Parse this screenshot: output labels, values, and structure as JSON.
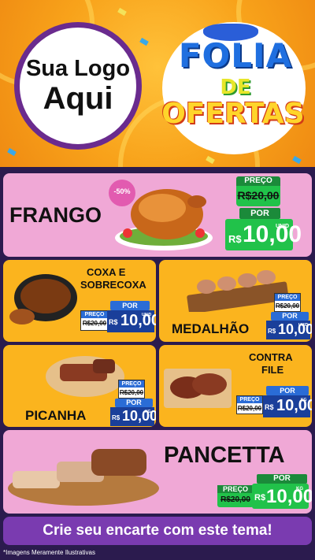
{
  "logo": {
    "line1": "Sua Logo",
    "line2": "Aqui"
  },
  "title": {
    "word1": "FOLIA",
    "word2": "DE",
    "word3": "OFERTAS"
  },
  "products": {
    "frango": {
      "name": "FRANGO",
      "discount": "-50%",
      "price_label": "PREÇO",
      "old_price": "R$20,00",
      "por_label": "POR",
      "currency": "R$",
      "price": "10,00",
      "unit": "UNID"
    },
    "coxa": {
      "name_line1": "COXA E",
      "name_line2": "SOBRECOXA",
      "price_label": "PREÇO",
      "old_price": "R$20,00",
      "por_label": "POR",
      "currency": "R$",
      "price": "10,00",
      "unit": "UNID"
    },
    "medalhao": {
      "name": "MEDALHÃO",
      "price_label": "PREÇO",
      "old_price": "R$20,00",
      "por_label": "POR",
      "currency": "R$",
      "price": "10,00",
      "unit": "UNID"
    },
    "picanha": {
      "name": "PICANHA",
      "price_label": "PREÇO",
      "old_price": "R$20,00",
      "por_label": "POR",
      "currency": "R$",
      "price": "10,00",
      "unit": "KG"
    },
    "contrafile": {
      "name_line1": "CONTRA",
      "name_line2": "FILE",
      "price_label": "PREÇO",
      "old_price": "R$20,00",
      "por_label": "POR",
      "currency": "R$",
      "price": "10,00",
      "unit": "KG"
    },
    "pancetta": {
      "name": "PANCETTA",
      "price_label": "PREÇO",
      "old_price": "R$20,00",
      "por_label": "POR",
      "currency": "R$",
      "price": "10,00",
      "unit": "KG"
    }
  },
  "banner": {
    "text": "Crie seu encarte com este tema!"
  },
  "footnote": {
    "text": "*Imagens Meramente Ilustrativas"
  },
  "colors": {
    "pink": "#f0a8d6",
    "yellow": "#fbb41e",
    "purple": "#7a3bb0",
    "green": "#21c24a",
    "blue": "#1a3f9a"
  }
}
